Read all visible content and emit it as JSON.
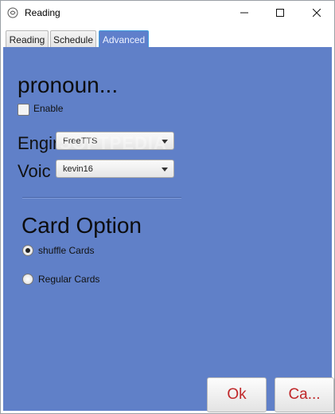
{
  "window": {
    "title": "Reading"
  },
  "tabs": [
    {
      "label": "Reading",
      "active": false
    },
    {
      "label": "Schedule",
      "active": false
    },
    {
      "label": "Advanced",
      "active": true
    }
  ],
  "pronounce": {
    "heading": "pronoun...",
    "enable_label": "Enable",
    "enable_checked": false,
    "engine_label": "Engine",
    "engine_value": "FreeTTS",
    "voice_label": "Voic",
    "voice_value": "kevin16"
  },
  "card_option": {
    "heading": "Card Option",
    "options": [
      {
        "label": "shuffle Cards",
        "selected": true
      },
      {
        "label": "Regular Cards",
        "selected": false
      }
    ]
  },
  "buttons": {
    "ok": "Ok",
    "cancel": "Ca..."
  },
  "watermark": "SOFTPEDIA",
  "colors": {
    "panel": "#6080c8",
    "button_text": "#c0282a"
  }
}
